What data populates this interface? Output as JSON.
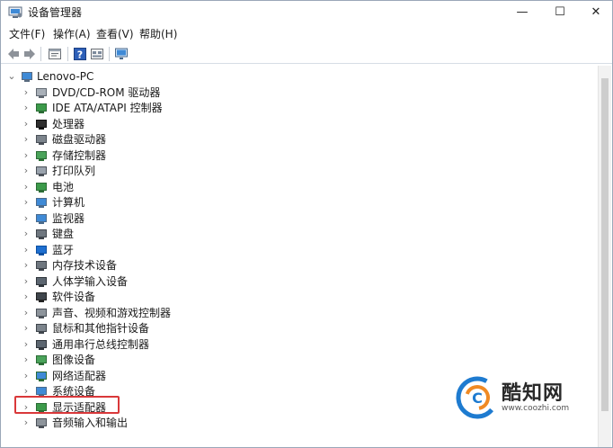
{
  "window": {
    "title": "设备管理器",
    "minimize_symbol": "—",
    "maximize_symbol": "☐",
    "close_symbol": "✕"
  },
  "menu": [
    {
      "label": "文件(F)"
    },
    {
      "label": "操作(A)"
    },
    {
      "label": "查看(V)"
    },
    {
      "label": "帮助(H)"
    }
  ],
  "toolbar": {
    "buttons": [
      "back-icon",
      "forward-icon",
      "properties-icon",
      "help-icon",
      "view-icon",
      "monitor-icon"
    ]
  },
  "tree": {
    "root": {
      "label": "Lenovo-PC",
      "expanded": true,
      "icon": "computer-icon"
    },
    "items": [
      {
        "label": "DVD/CD-ROM 驱动器",
        "icon": "dvd-drive-icon"
      },
      {
        "label": "IDE ATA/ATAPI 控制器",
        "icon": "ide-controller-icon"
      },
      {
        "label": "处理器",
        "icon": "processor-icon"
      },
      {
        "label": "磁盘驱动器",
        "icon": "disk-drive-icon"
      },
      {
        "label": "存储控制器",
        "icon": "storage-controller-icon"
      },
      {
        "label": "打印队列",
        "icon": "printer-icon"
      },
      {
        "label": "电池",
        "icon": "battery-icon"
      },
      {
        "label": "计算机",
        "icon": "computer-monitor-icon"
      },
      {
        "label": "监视器",
        "icon": "monitor-icon"
      },
      {
        "label": "键盘",
        "icon": "keyboard-icon"
      },
      {
        "label": "蓝牙",
        "icon": "bluetooth-icon"
      },
      {
        "label": "内存技术设备",
        "icon": "memory-device-icon"
      },
      {
        "label": "人体学输入设备",
        "icon": "hid-icon"
      },
      {
        "label": "软件设备",
        "icon": "software-device-icon"
      },
      {
        "label": "声音、视频和游戏控制器",
        "icon": "sound-icon"
      },
      {
        "label": "鼠标和其他指针设备",
        "icon": "mouse-icon"
      },
      {
        "label": "通用串行总线控制器",
        "icon": "usb-icon"
      },
      {
        "label": "图像设备",
        "icon": "camera-icon"
      },
      {
        "label": "网络适配器",
        "icon": "network-adapter-icon"
      },
      {
        "label": "系统设备",
        "icon": "system-device-icon"
      },
      {
        "label": "显示适配器",
        "icon": "display-adapter-icon",
        "highlighted": true
      },
      {
        "label": "音频输入和输出",
        "icon": "audio-io-icon"
      }
    ]
  },
  "watermark": {
    "brand": "酷知网",
    "url": "www.coozhi.com"
  },
  "colors": {
    "highlight_border": "#d9383a",
    "accent_blue": "#1e7bd0"
  }
}
